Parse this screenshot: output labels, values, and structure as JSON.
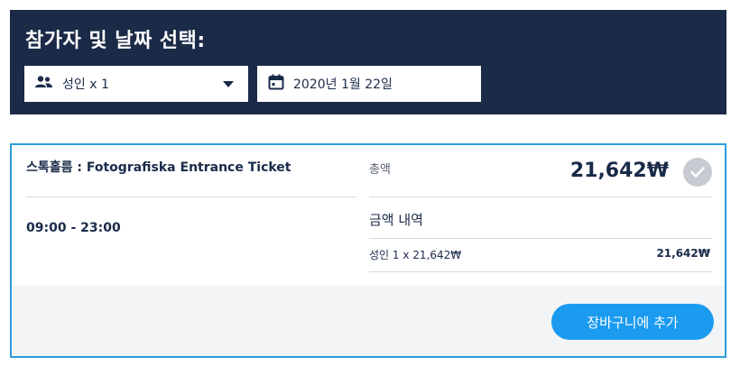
{
  "header": {
    "title": "참가자 및 날짜 선택:",
    "participants_value": "성인 x 1",
    "date_value": "2020년 1월 22일"
  },
  "offer": {
    "product_title": "스톡홀름 : Fotografiska Entrance Ticket",
    "time_slot": "09:00 - 23:00",
    "total_label": "총액",
    "total_price": "21,642₩",
    "breakdown_title": "금액 내역",
    "breakdown_rows": [
      {
        "label": "성인  1 x 21,642₩",
        "value": "21,642₩"
      }
    ],
    "cart_button_label": "장바구니에 추가"
  },
  "colors": {
    "header_bg": "#1b2a47",
    "accent": "#1a9bf0",
    "card_border": "#2d9cdb"
  },
  "icons": {
    "participants": "people-icon",
    "date": "calendar-icon",
    "dropdown": "caret-down-icon",
    "selected": "check-circle-icon"
  }
}
